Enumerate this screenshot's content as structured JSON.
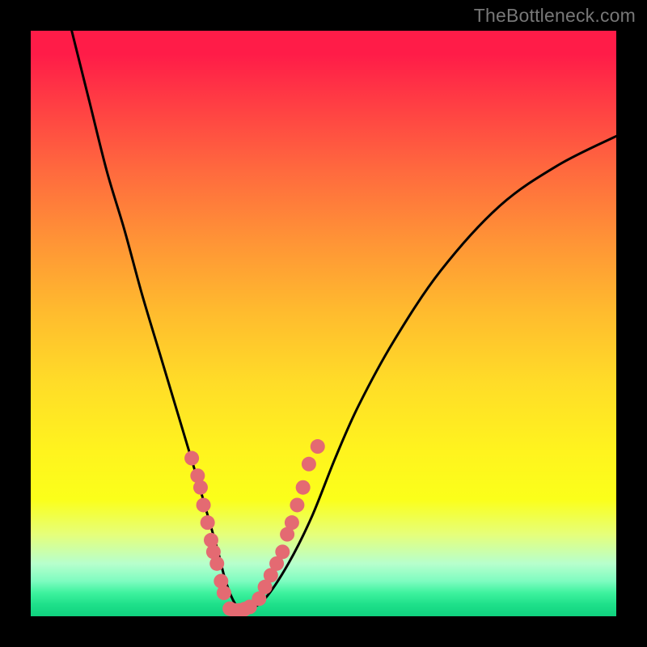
{
  "watermark": "TheBottleneck.com",
  "chart_data": {
    "type": "line",
    "title": "",
    "xlabel": "",
    "ylabel": "",
    "xlim": [
      0,
      100
    ],
    "ylim": [
      0,
      100
    ],
    "grid": false,
    "legend": false,
    "notes": "Black V-shaped bottleneck curve over rainbow gradient (red=top, green=bottom). Pink dots cluster on both arms of the V near the trough.",
    "series": [
      {
        "name": "curve",
        "color": "#000000",
        "type": "line",
        "x": [
          7,
          10,
          13,
          16,
          19,
          22,
          25,
          28,
          30,
          32,
          33,
          34,
          35,
          36,
          37,
          40,
          44,
          48,
          52,
          56,
          62,
          70,
          80,
          90,
          100
        ],
        "y": [
          100,
          88,
          76,
          66,
          55,
          45,
          35,
          25,
          18,
          11,
          7,
          4,
          2,
          1,
          1,
          3,
          9,
          17,
          27,
          36,
          47,
          59,
          70,
          77,
          82
        ]
      },
      {
        "name": "left-dots",
        "color": "#e46a72",
        "type": "scatter",
        "x": [
          27.5,
          28.5,
          29.0,
          29.5,
          30.2,
          30.8,
          31.2,
          31.8,
          32.5,
          33.0
        ],
        "y": [
          27,
          24,
          22,
          19,
          16,
          13,
          11,
          9,
          6,
          4
        ]
      },
      {
        "name": "bottom-dots",
        "color": "#e46a72",
        "type": "scatter",
        "x": [
          34.0,
          34.8,
          35.6,
          36.5,
          37.4
        ],
        "y": [
          1.3,
          1.0,
          1.0,
          1.2,
          1.6
        ]
      },
      {
        "name": "right-dots",
        "color": "#e46a72",
        "type": "scatter",
        "x": [
          39.0,
          40.0,
          41.0,
          42.0,
          43.0,
          43.8,
          44.6,
          45.5,
          46.5,
          47.5,
          49.0
        ],
        "y": [
          3,
          5,
          7,
          9,
          11,
          14,
          16,
          19,
          22,
          26,
          29
        ]
      }
    ]
  }
}
